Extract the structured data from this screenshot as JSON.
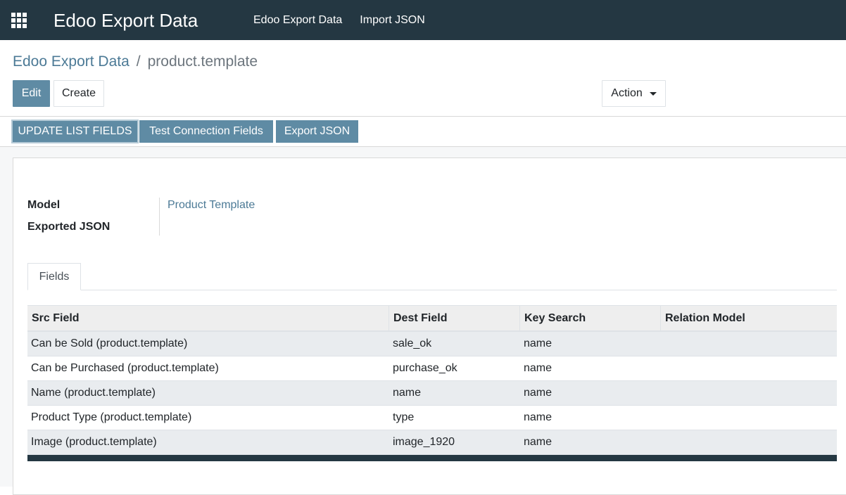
{
  "navbar": {
    "brand": "Edoo Export Data",
    "menu": [
      "Edoo Export Data",
      "Import JSON"
    ]
  },
  "breadcrumb": {
    "parent": "Edoo Export Data",
    "separator": "/",
    "current": "product.template"
  },
  "buttons": {
    "edit": "Edit",
    "create": "Create",
    "action": "Action"
  },
  "statusbar": {
    "update": "UPDATE LIST FIELDS",
    "test": "Test Connection Fields",
    "export": "Export JSON"
  },
  "form": {
    "model_label": "Model",
    "model_value": "Product Template",
    "json_label": "Exported JSON"
  },
  "tabs": {
    "fields": "Fields"
  },
  "table": {
    "headers": [
      "Src Field",
      "Dest Field",
      "Key Search",
      "Relation Model"
    ],
    "rows": [
      [
        "Can be Sold (product.template)",
        "sale_ok",
        "name",
        ""
      ],
      [
        "Can be Purchased (product.template)",
        "purchase_ok",
        "name",
        ""
      ],
      [
        "Name (product.template)",
        "name",
        "name",
        ""
      ],
      [
        "Product Type (product.template)",
        "type",
        "name",
        ""
      ],
      [
        "Image (product.template)",
        "image_1920",
        "name",
        ""
      ]
    ]
  },
  "colors": {
    "navbar": "#243742",
    "primary": "#5f8ba4",
    "link": "#4c7a96"
  }
}
